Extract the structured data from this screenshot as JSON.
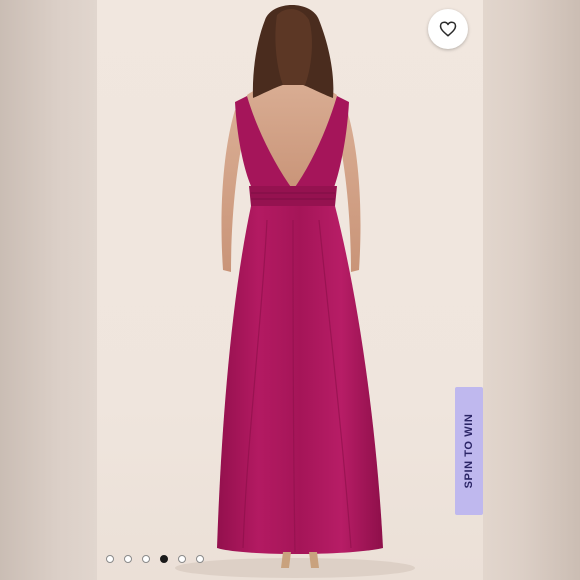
{
  "listing": {
    "spin_label": "SPIN TO WIN",
    "like_icon": "heart-icon",
    "carousel": {
      "count": 6,
      "active_index": 3
    },
    "colors": {
      "dress": "#b0175f",
      "spin_bg": "#bfb8ee",
      "spin_text": "#2b2566"
    }
  }
}
